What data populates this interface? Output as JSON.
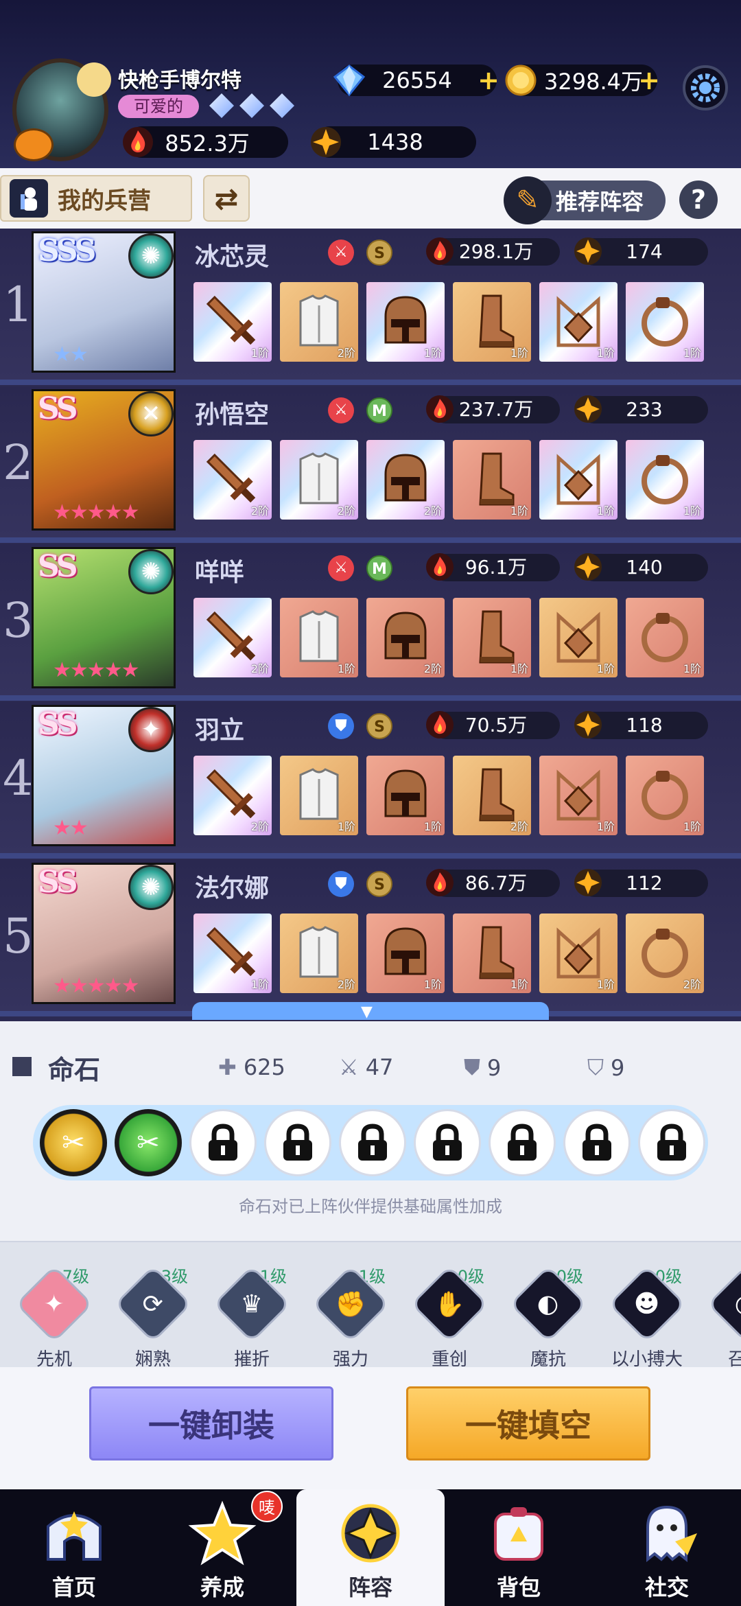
{
  "player": {
    "name": "快枪手博尔特",
    "tag": "可爱的",
    "power": "852.3万",
    "level_value": "1438"
  },
  "currency": {
    "diamonds": "26554",
    "gold": "3298.4万"
  },
  "subbar": {
    "barracks_label": "我的兵营",
    "recommend_label": "推荐阵容",
    "help_label": "?"
  },
  "heroes": [
    {
      "slot": "1",
      "rank": "SSS",
      "name": "冰芯灵",
      "badge2": "S",
      "power": "298.1万",
      "star_value": "174",
      "element_color": "#2fa89a",
      "gear": [
        [
          "shiny",
          "1阶"
        ],
        [
          "gold",
          "2阶"
        ],
        [
          "shiny",
          "1阶"
        ],
        [
          "gold",
          "1阶"
        ],
        [
          "shiny",
          "1阶"
        ],
        [
          "shiny",
          "1阶"
        ]
      ]
    },
    {
      "slot": "2",
      "rank": "SS",
      "name": "孙悟空",
      "badge2": "M",
      "power": "237.7万",
      "star_value": "233",
      "element_color": "#d8a020",
      "gear": [
        [
          "shiny",
          "2阶"
        ],
        [
          "shiny",
          "2阶"
        ],
        [
          "shiny",
          "2阶"
        ],
        [
          "salmon",
          "1阶"
        ],
        [
          "shiny",
          "1阶"
        ],
        [
          "shiny",
          "1阶"
        ]
      ]
    },
    {
      "slot": "3",
      "rank": "SS",
      "name": "咩咩",
      "badge2": "M",
      "power": "96.1万",
      "star_value": "140",
      "element_color": "#2fa89a",
      "gear": [
        [
          "shiny",
          "2阶"
        ],
        [
          "salmon",
          "1阶"
        ],
        [
          "salmon",
          "2阶"
        ],
        [
          "salmon",
          "1阶"
        ],
        [
          "gold",
          "1阶"
        ],
        [
          "salmon",
          "1阶"
        ]
      ]
    },
    {
      "slot": "4",
      "rank": "SS",
      "name": "羽立",
      "badge2": "S",
      "power": "70.5万",
      "star_value": "118",
      "element_color": "#c0302a",
      "gear": [
        [
          "shiny",
          "2阶"
        ],
        [
          "gold",
          "1阶"
        ],
        [
          "salmon",
          "1阶"
        ],
        [
          "gold",
          "2阶"
        ],
        [
          "salmon",
          "1阶"
        ],
        [
          "salmon",
          "1阶"
        ]
      ]
    },
    {
      "slot": "5",
      "rank": "SS",
      "name": "法尔娜",
      "badge2": "S",
      "power": "86.7万",
      "star_value": "112",
      "element_color": "#2fa89a",
      "gear": [
        [
          "shiny",
          "1阶"
        ],
        [
          "gold",
          "2阶"
        ],
        [
          "salmon",
          "1阶"
        ],
        [
          "salmon",
          "1阶"
        ],
        [
          "gold",
          "1阶"
        ],
        [
          "gold",
          "2阶"
        ]
      ]
    }
  ],
  "mingshi": {
    "title": "命石",
    "hp": "625",
    "atk": "47",
    "def": "9",
    "mdef": "9",
    "note": "命石对已上阵伙伴提供基础属性加成"
  },
  "skills": [
    {
      "name": "先机",
      "level": "7级",
      "color": "#f08aa0",
      "glyph": "✦"
    },
    {
      "name": "娴熟",
      "level": "3级",
      "color": "#3e4a66",
      "glyph": "⟳"
    },
    {
      "name": "摧折",
      "level": "1级",
      "color": "#3e4a66",
      "glyph": "♛"
    },
    {
      "name": "强力",
      "level": "1级",
      "color": "#3e4a66",
      "glyph": "✊"
    },
    {
      "name": "重创",
      "level": "0级",
      "color": "#16162a",
      "glyph": "✋"
    },
    {
      "name": "魔抗",
      "level": "0级",
      "color": "#16162a",
      "glyph": "◐"
    },
    {
      "name": "以小搏大",
      "level": "0级",
      "color": "#16162a",
      "glyph": "☻"
    },
    {
      "name": "召唤",
      "level": "",
      "color": "#16162a",
      "glyph": "◎"
    }
  ],
  "actions": {
    "unequip_all": "一键卸装",
    "fill_all": "一键填空"
  },
  "nav": [
    {
      "label": "首页"
    },
    {
      "label": "养成",
      "badge": "唛"
    },
    {
      "label": "阵容"
    },
    {
      "label": "背包"
    },
    {
      "label": "社交"
    }
  ]
}
